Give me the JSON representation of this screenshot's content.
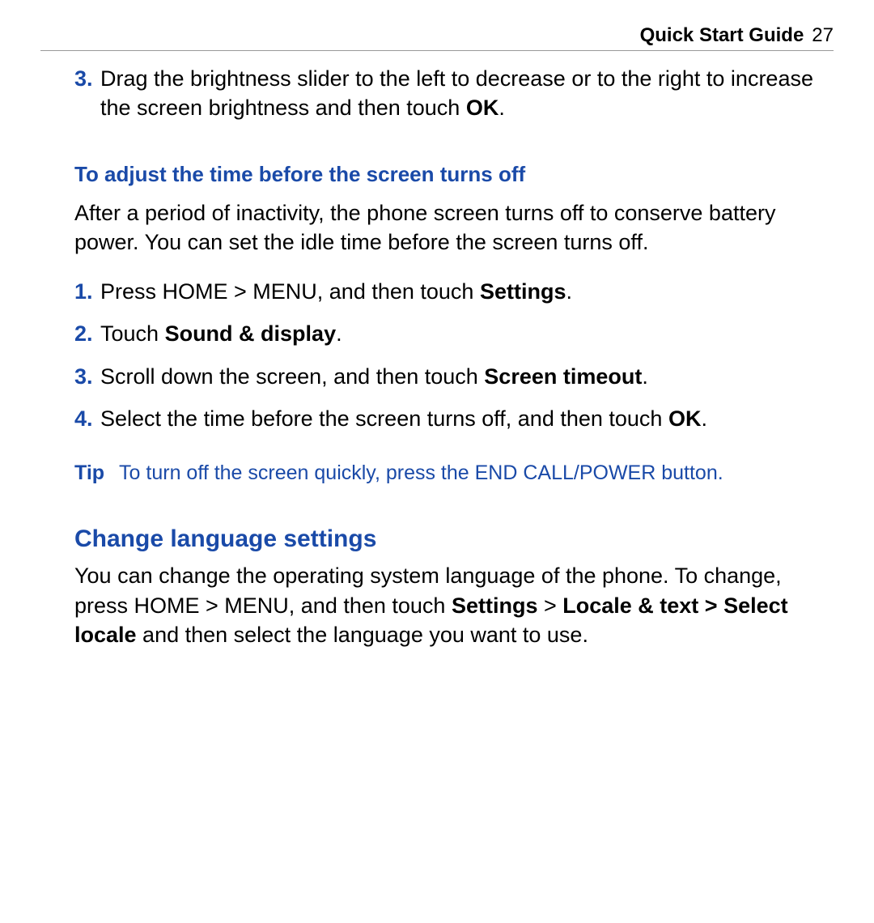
{
  "header": {
    "title": "Quick Start Guide",
    "page_number": "27"
  },
  "top_step": {
    "number": "3.",
    "text_before": "Drag the brightness slider to the left to decrease or to the right to increase the screen brightness and then touch ",
    "bold": "OK",
    "text_after": "."
  },
  "section1": {
    "subheading": "To adjust the time before the screen turns off",
    "intro": "After a period of inactivity, the phone screen turns off to conserve battery power. You can set the idle time before the screen turns off.",
    "steps": [
      {
        "number": "1.",
        "parts": [
          {
            "t": "Press HOME > MENU, and then touch ",
            "b": false
          },
          {
            "t": "Settings",
            "b": true
          },
          {
            "t": ".",
            "b": false
          }
        ]
      },
      {
        "number": "2.",
        "parts": [
          {
            "t": "Touch ",
            "b": false
          },
          {
            "t": "Sound & display",
            "b": true
          },
          {
            "t": ".",
            "b": false
          }
        ]
      },
      {
        "number": "3.",
        "parts": [
          {
            "t": "Scroll down the screen, and then touch ",
            "b": false
          },
          {
            "t": "Screen timeout",
            "b": true
          },
          {
            "t": ".",
            "b": false
          }
        ]
      },
      {
        "number": "4.",
        "parts": [
          {
            "t": "Select the time before the screen turns off, and then touch ",
            "b": false
          },
          {
            "t": "OK",
            "b": true
          },
          {
            "t": ".",
            "b": false
          }
        ]
      }
    ],
    "tip": {
      "label": "Tip",
      "content": "To turn off the screen quickly, press the END CALL/POWER button."
    }
  },
  "section2": {
    "heading": "Change language settings",
    "parts": [
      {
        "t": "You can change the operating system language of the phone. To change, press HOME > MENU, and then touch ",
        "b": false
      },
      {
        "t": "Settings",
        "b": true
      },
      {
        "t": " > ",
        "b": false
      },
      {
        "t": "Locale & text > Select locale",
        "b": true
      },
      {
        "t": " and then select the language you want to use.",
        "b": false
      }
    ]
  }
}
